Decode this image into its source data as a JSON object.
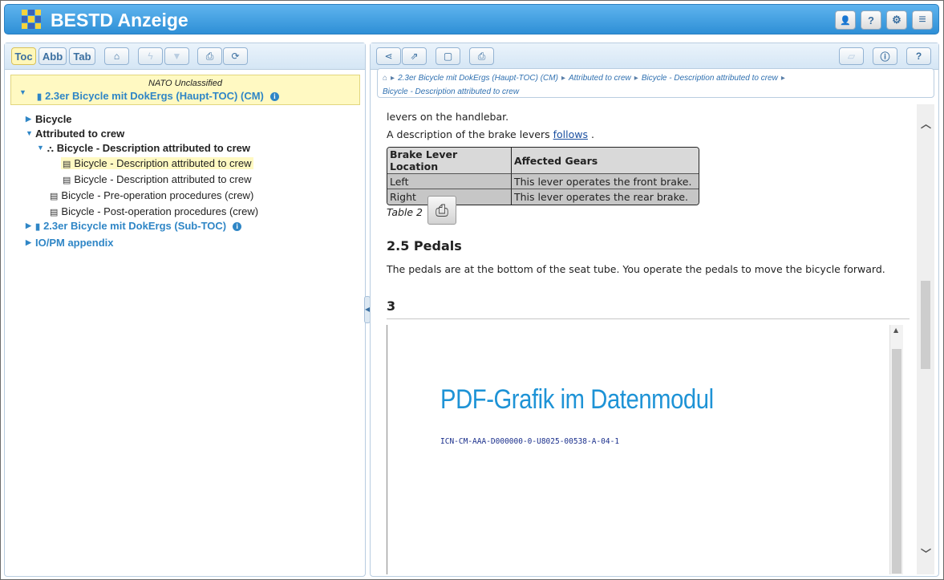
{
  "app": {
    "title": "BESTD Anzeige",
    "header_buttons": [
      {
        "icon": "user-icon",
        "glyph": "👤"
      },
      {
        "icon": "help-icon",
        "glyph": "?"
      },
      {
        "icon": "gear-icon",
        "glyph": "⚙"
      },
      {
        "icon": "menu-icon",
        "glyph": "≡"
      }
    ]
  },
  "left": {
    "tabs": [
      "Toc",
      "Abb",
      "Tab"
    ],
    "active_tab": "Toc",
    "classification": "NATO Unclassified",
    "root_title": "2.3er Bicycle mit DokErgs (Haupt-TOC) (CM)",
    "tree": {
      "bicycle": "Bicycle",
      "attributed": "Attributed to crew",
      "desc_group": "Bicycle - Description attributed to crew",
      "desc_1": "Bicycle - Description attributed to crew",
      "desc_2": "Bicycle - Description attributed to crew",
      "preop": "Bicycle - Pre-operation procedures (crew)",
      "postop": "Bicycle - Post-operation procedures (crew)",
      "subtoc": "2.3er Bicycle mit DokErgs (Sub-TOC)",
      "iopm": "IO/PM appendix"
    }
  },
  "right": {
    "breadcrumb": {
      "c1": "2.3er Bicycle mit DokErgs (Haupt-TOC) (CM)",
      "c2": "Attributed to crew",
      "c3": "Bicycle - Description attributed to crew",
      "c4": "Bicycle - Description attributed to crew"
    },
    "content": {
      "line1": "levers on the handlebar.",
      "line2_pre": "A description of the brake levers",
      "line2_link": "follows",
      "line2_post": ".",
      "table": {
        "headers": [
          "Brake Lever Location",
          "Affected Gears"
        ],
        "rows": [
          [
            "Left",
            "This lever operates the front brake."
          ],
          [
            "Right",
            "This lever operates the rear brake."
          ]
        ]
      },
      "table_caption": "Table 2",
      "h_pedals": "2.5 Pedals",
      "pedals_text": "The pedals are at the bottom of the seat tube. You operate the pedals to move the bicycle forward.",
      "h_3": "3",
      "pdf_title": "PDF-Grafik im Datenmodul",
      "pdf_icn": "ICN-CM-AAA-D000000-0-U8025-00538-A-04-1"
    }
  },
  "colors": {
    "header": "#2e8fd6",
    "link": "#2f86c6",
    "highlight": "#fff9c2",
    "pdf_title": "#1e93d6"
  }
}
